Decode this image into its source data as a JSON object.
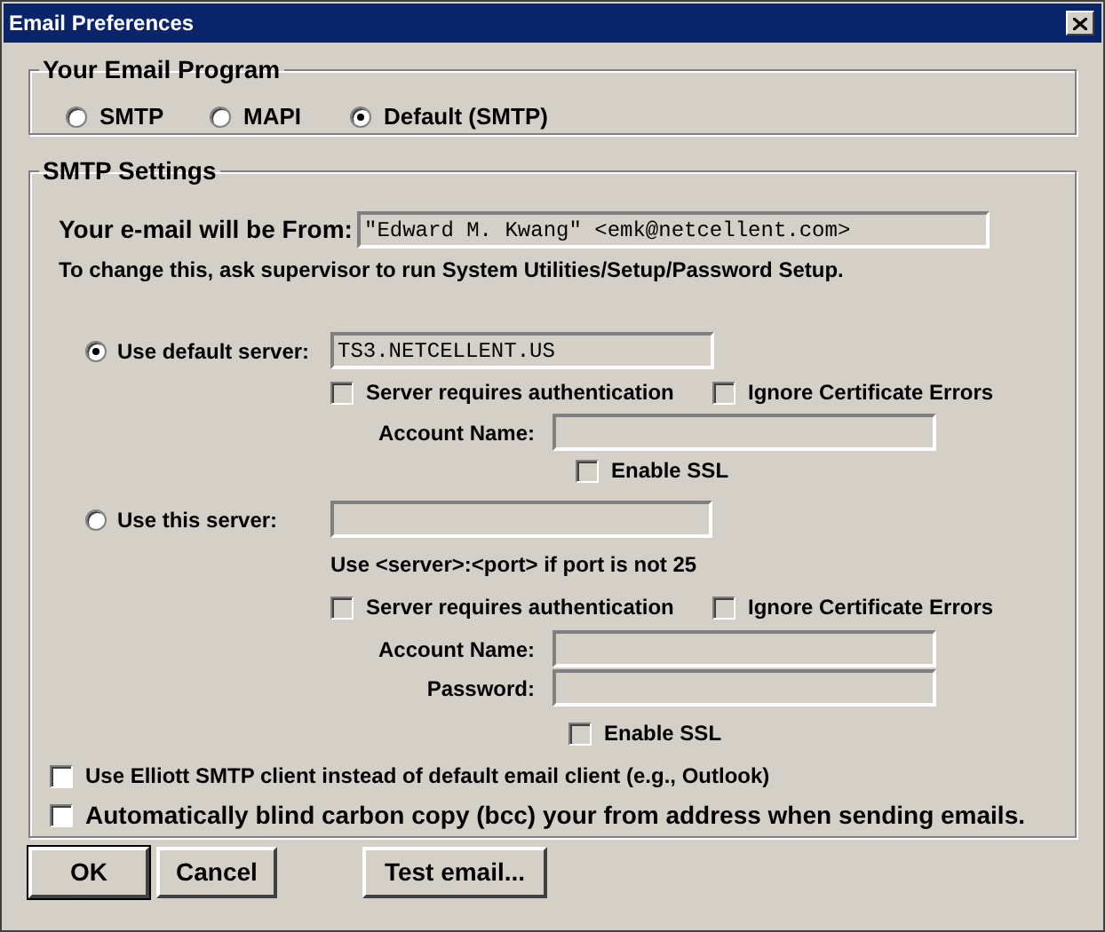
{
  "window": {
    "title": "Email Preferences"
  },
  "email_program": {
    "title": "Your Email Program",
    "options": [
      {
        "label": "SMTP",
        "selected": false
      },
      {
        "label": "MAPI",
        "selected": false
      },
      {
        "label": "Default (SMTP)",
        "selected": true
      }
    ]
  },
  "smtp_settings": {
    "title": "SMTP Settings",
    "from": {
      "label": "Your e-mail will be From:",
      "value": "\"Edward M. Kwang\" <emk@netcellent.com>",
      "disabled": true
    },
    "note": "To change this, ask supervisor to run System Utilities/Setup/Password Setup.",
    "default_server": {
      "label": "Use default server:",
      "selected": true,
      "value": "TS3.NETCELLENT.US",
      "disabled": true,
      "auth": {
        "label": "Server requires authentication",
        "checked": false,
        "disabled": true
      },
      "ignore_cert": {
        "label": "Ignore Certificate Errors",
        "checked": false,
        "disabled": true
      },
      "account_name": {
        "label": "Account Name:",
        "disabled": true
      },
      "enable_ssl": {
        "label": "Enable SSL",
        "checked": false,
        "disabled": true
      }
    },
    "custom_server": {
      "label": "Use this server:",
      "selected": false,
      "disabled": true,
      "hint": "Use <server>:<port> if port is not 25",
      "auth": {
        "label": "Server requires authentication",
        "checked": false,
        "disabled": true
      },
      "ignore_cert": {
        "label": "Ignore Certificate Errors",
        "checked": false,
        "disabled": true
      },
      "account_name": {
        "label": "Account Name:",
        "disabled": true
      },
      "password": {
        "label": "Password:",
        "disabled": true
      },
      "enable_ssl": {
        "label": "Enable SSL",
        "checked": false,
        "disabled": true
      }
    },
    "options": [
      {
        "label": "Use Elliott SMTP client instead of default email client (e.g., Outlook)",
        "checked": false,
        "disabled": false,
        "large": false
      },
      {
        "label": "Automatically blind carbon copy (bcc) your from address when sending emails.",
        "checked": false,
        "disabled": false,
        "large": true
      }
    ]
  },
  "buttons": [
    {
      "label": "OK",
      "default": true
    },
    {
      "label": "Cancel",
      "default": false
    },
    {
      "label": "Test email...",
      "default": false
    }
  ]
}
